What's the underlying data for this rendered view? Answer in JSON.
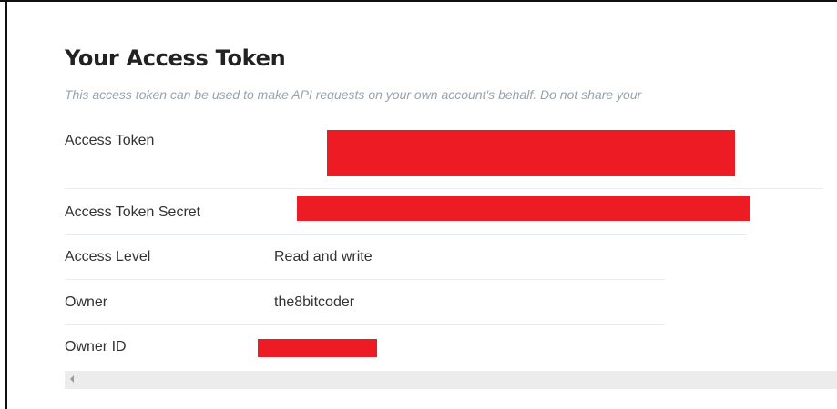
{
  "page": {
    "title": "Your Access Token",
    "subtitle": "This access token can be used to make API requests on your own account's behalf. Do not share your"
  },
  "fields": [
    {
      "label": "Access Token",
      "value": null,
      "redacted": true
    },
    {
      "label": "Access Token Secret",
      "value": null,
      "redacted": true
    },
    {
      "label": "Access Level",
      "value": "Read and write",
      "redacted": false
    },
    {
      "label": "Owner",
      "value": "the8bitcoder",
      "redacted": false
    },
    {
      "label": "Owner ID",
      "value": null,
      "redacted": true
    }
  ],
  "colors": {
    "redaction": "#ed1c24",
    "subtitle": "#99a3ab",
    "divider": "#e6ecf0"
  },
  "icons": {
    "scroll_left": "triangle-left-icon"
  }
}
